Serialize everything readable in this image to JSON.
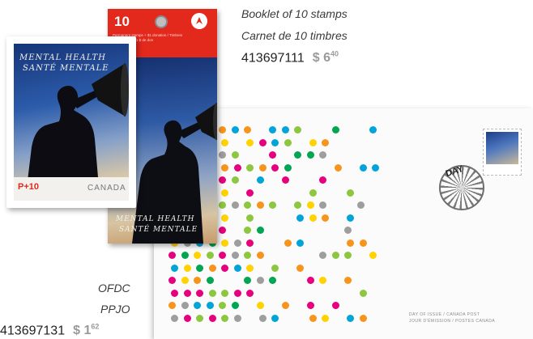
{
  "booklet_caption": {
    "line1": "Booklet of 10 stamps",
    "line2": "Carnet de 10 timbres",
    "product_number": "413697111",
    "price_dollars": "$ 6",
    "price_cents": "40"
  },
  "ofdc_caption": {
    "line1": "OFDC",
    "line2": "PPJO",
    "product_number": "413697131",
    "price_dollars": "$ 1",
    "price_cents": "62"
  },
  "stamp": {
    "title_line1": "MENTAL HEALTH",
    "title_line2": "SANTÉ MENTALE",
    "denomination": "P+10",
    "country": "CANADA"
  },
  "booklet": {
    "count": "10",
    "cover_fine_print": "Permanent stamps + $1 donation / Timbres permanents + 1 $ de don",
    "info_heading": "Mental Health",
    "title_line1": "MENTAL HEALTH",
    "title_line2": "SANTÉ MENTALE"
  },
  "envelope": {
    "cancel_text": "DAY",
    "fine_print_line1": "DAY OF ISSUE / CANADA POST",
    "fine_print_line2": "JOUR D'ÉMISSION / POSTES CANADA"
  },
  "colors": {
    "canada_post_red": "#e3281c",
    "dot_palette": [
      "#e6007e",
      "#00a4d9",
      "#ffd200",
      "#8dc63f",
      "#f7941d",
      "#9e9e9e",
      "#00a651"
    ]
  },
  "icons": {
    "canada_post_logo": "canada-post-logo-icon",
    "megaphone": "megaphone-icon"
  }
}
